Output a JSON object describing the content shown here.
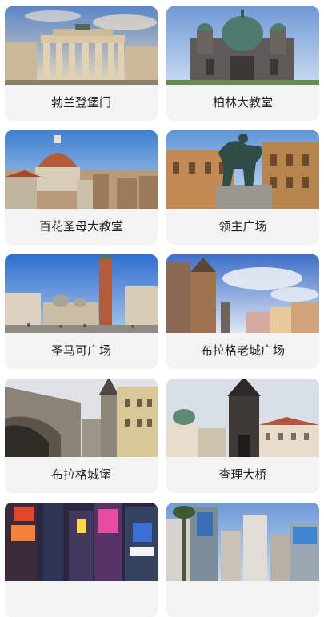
{
  "attractions": [
    {
      "name": "勃兰登堡门",
      "image": "brandenburg-gate-photo"
    },
    {
      "name": "柏林大教堂",
      "image": "berlin-cathedral-photo"
    },
    {
      "name": "百花圣母大教堂",
      "image": "florence-cathedral-photo"
    },
    {
      "name": "领主广场",
      "image": "piazza-della-signoria-photo"
    },
    {
      "name": "圣马可广场",
      "image": "st-marks-square-photo"
    },
    {
      "name": "布拉格老城广场",
      "image": "prague-old-town-square-photo"
    },
    {
      "name": "布拉格城堡",
      "image": "prague-castle-photo"
    },
    {
      "name": "查理大桥",
      "image": "charles-bridge-photo"
    },
    {
      "name": "",
      "image": "neon-city-street-photo"
    },
    {
      "name": "",
      "image": "city-street-skyline-photo"
    }
  ]
}
